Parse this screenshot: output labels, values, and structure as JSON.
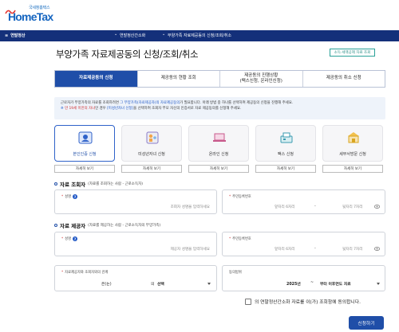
{
  "logo": {
    "sub": "국세청홈택스",
    "main": "HomeTax"
  },
  "nav": {
    "menu_label": "연말정산",
    "crumbs": [
      "연말정산간소화",
      "부양가족 자료제공동의 신청/조회/취소"
    ]
  },
  "page": {
    "title": "부양가족 자료제공동의 신청/조회/취소",
    "help_tag": "소득·세액공제 자료 조회"
  },
  "tabs": [
    {
      "label": "자료제공동의 신청",
      "active": true
    },
    {
      "label": "제공동의 현황 조회",
      "active": false
    },
    {
      "label": "제공동의 진행상황\n(팩스신청, 온라인신청)",
      "active": false
    },
    {
      "label": "제공동의 취소 신청",
      "active": false
    }
  ],
  "notice": {
    "line1_pre": "근로자가 부양가족의 자료를 조회하려면 ",
    "line1_hl": "그 부양가족(자료제공자)의 자료제공동의",
    "line1_post": "가 필요합니다. 아래 방법 중 하나를 선택하여 제공동의 신청을 진행해 주세요.",
    "line2_mark": "※ ",
    "line2_red": "만 19세 미만의 자녀",
    "line2_mid": "인 경우 ",
    "line2_hl": "[미성년자녀 신청]",
    "line2_post": "을 선택하여 조회자 부모 자신의 인증서로 자료 제공동의를 신청해 주세요."
  },
  "methods": [
    {
      "label": "본인인증 신청",
      "icon": "id-card-icon",
      "active": true
    },
    {
      "label": "미성년자녀 신청",
      "icon": "child-icon",
      "active": false
    },
    {
      "label": "온라인 신청",
      "icon": "laptop-icon",
      "active": false
    },
    {
      "label": "팩스 신청",
      "icon": "fax-icon",
      "active": false
    },
    {
      "label": "세무서방문 신청",
      "icon": "tax-office-icon",
      "active": false
    }
  ],
  "detail_label": "자세히 보기",
  "viewer_section": {
    "title": "자료 조회자",
    "subtitle": "(자료를 조회하는 사람 - 근로소득자)"
  },
  "provider_section": {
    "title": "자료 제공자",
    "subtitle": "(자료를 제공하는 사람 - 근로소득자의 부양가족)"
  },
  "viewer": {
    "name_label": "성명",
    "name_placeholder": "조회자 성명을 입력하세요",
    "rrn_label": "주민등록번호",
    "rrn_front_placeholder": "앞자리 6자리",
    "rrn_back_placeholder": "뒷자리 7자리"
  },
  "provider": {
    "name_label": "성명",
    "name_placeholder": "제공자 성명을 입력하세요",
    "rrn_label": "주민등록번호",
    "rrn_front_placeholder": "앞자리 6자리",
    "rrn_back_placeholder": "뒷자리 7자리"
  },
  "relation": {
    "label": "자료제공자와 조회자와의 관계",
    "prefix": "은(는)",
    "mid": "의",
    "value": "선택"
  },
  "period": {
    "label": "동의범위",
    "year": "2025년",
    "dash": "~",
    "value": "부터 이후연도 자료"
  },
  "consent_text": "의 연말정산간소화 자료를 이(가) 조회함에 동의합니다.",
  "submit_label": "신청하기",
  "colors": {
    "navy": "#14307a",
    "primary": "#1f4ea8",
    "red": "#d03030"
  }
}
